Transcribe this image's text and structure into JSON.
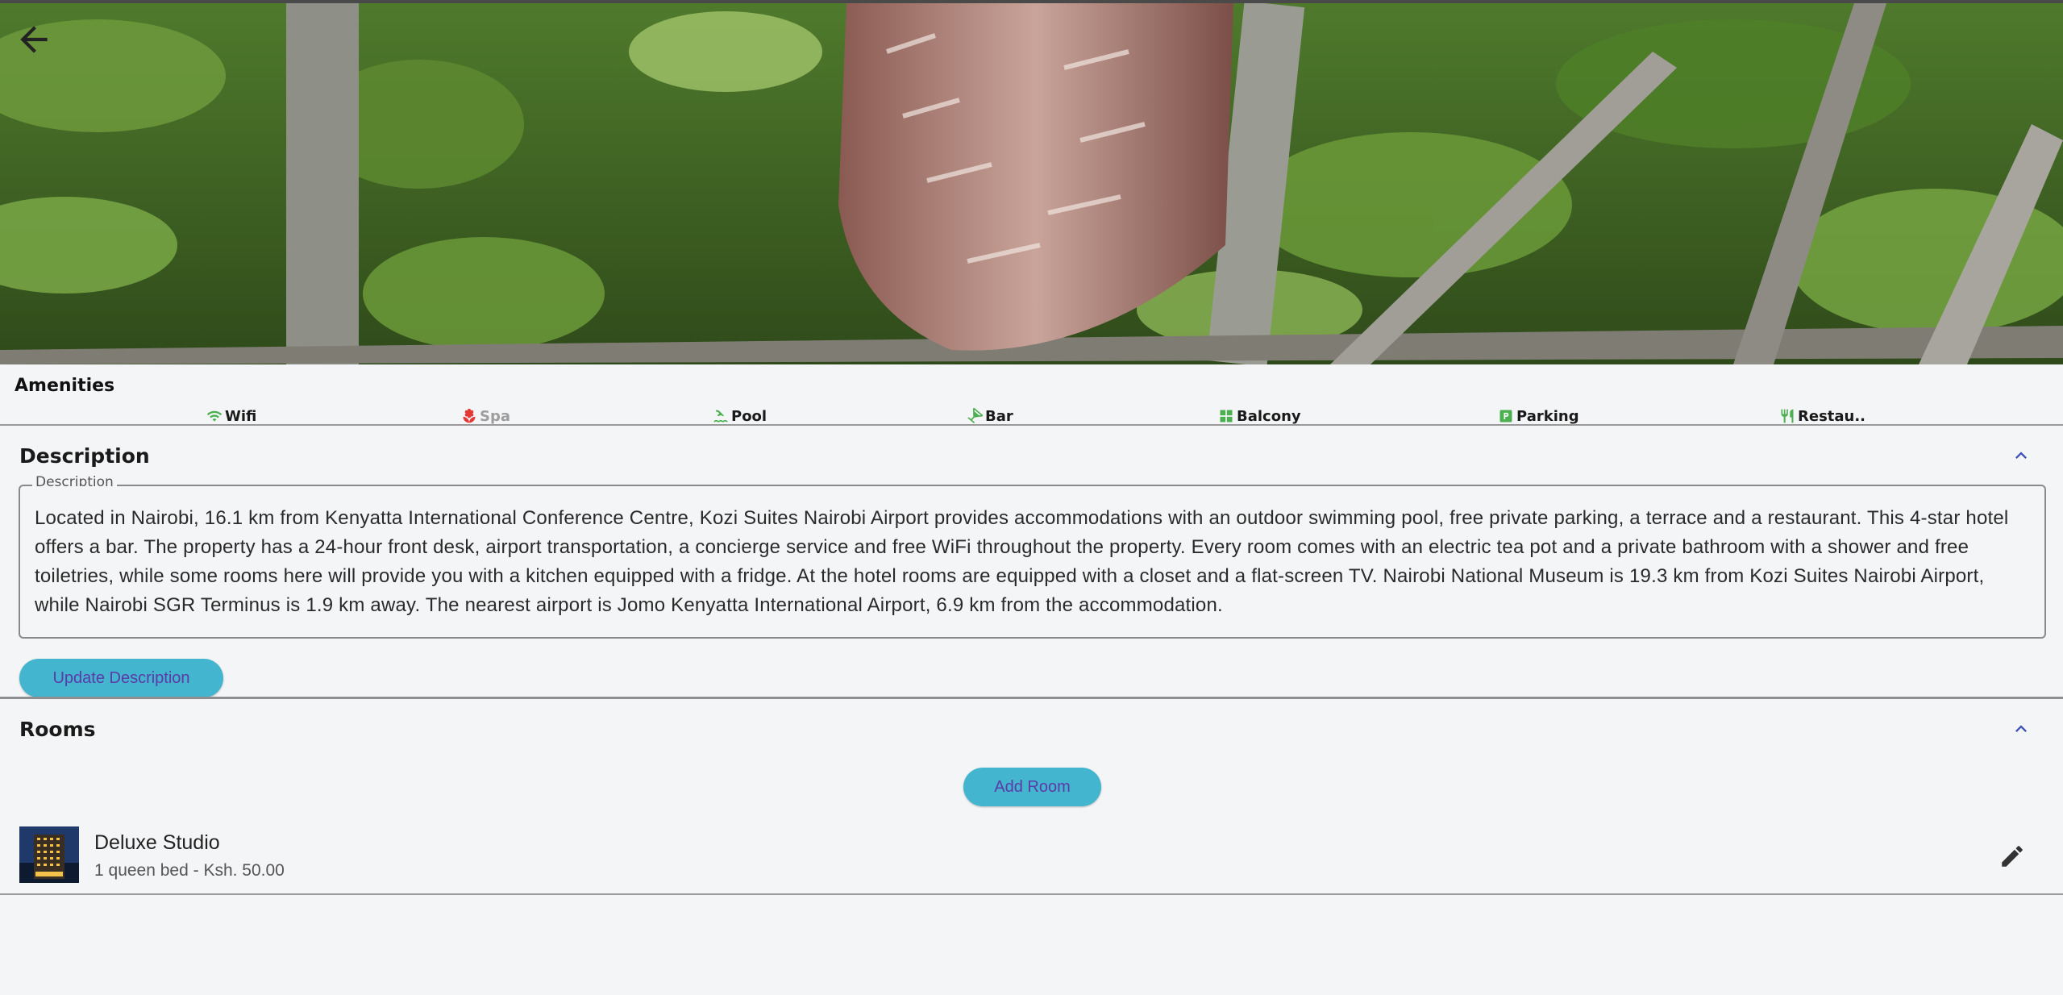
{
  "header": {
    "back_icon": "arrow-back-icon"
  },
  "amenities": {
    "title": "Amenities",
    "items": [
      {
        "label": "Wifi",
        "icon": "wifi-icon",
        "color": "#4caf50",
        "enabled": true
      },
      {
        "label": "Spa",
        "icon": "spa-icon",
        "color": "#e53935",
        "enabled": false
      },
      {
        "label": "Pool",
        "icon": "pool-icon",
        "color": "#4caf50",
        "enabled": true
      },
      {
        "label": "Bar",
        "icon": "bar-icon",
        "color": "#4caf50",
        "enabled": true
      },
      {
        "label": "Balcony",
        "icon": "balcony-icon",
        "color": "#4caf50",
        "enabled": true
      },
      {
        "label": "Parking",
        "icon": "parking-icon",
        "color": "#4caf50",
        "enabled": true
      },
      {
        "label": "Restau..",
        "icon": "restaurant-icon",
        "color": "#4caf50",
        "enabled": true
      }
    ]
  },
  "description": {
    "section_title": "Description",
    "field_label": "Description",
    "text": "Located in Nairobi, 16.1 km from Kenyatta International Conference Centre, Kozi Suites Nairobi Airport provides accommodations with an outdoor swimming pool, free private parking, a terrace and a restaurant. This 4-star hotel offers a bar. The property has a 24-hour front desk, airport transportation, a concierge service and free WiFi throughout the property.  Every room comes with an electric tea pot and a private bathroom with a shower and free toiletries, while some rooms here will provide you with a kitchen equipped with a fridge. At the hotel rooms are equipped with a closet and a flat-screen TV.  Nairobi National Museum is 19.3 km from Kozi Suites Nairobi Airport, while Nairobi SGR Terminus is 1.9 km away. The nearest airport is Jomo Kenyatta International Airport, 6.9 km from the accommodation.",
    "update_button": "Update Description"
  },
  "rooms": {
    "section_title": "Rooms",
    "add_button": "Add Room",
    "items": [
      {
        "name": "Deluxe Studio",
        "details": "1 queen bed - Ksh. 50.00"
      }
    ]
  },
  "colors": {
    "accent_button": "#43b5cf",
    "button_text": "#5c3aa8",
    "chevron": "#3f51b5"
  }
}
